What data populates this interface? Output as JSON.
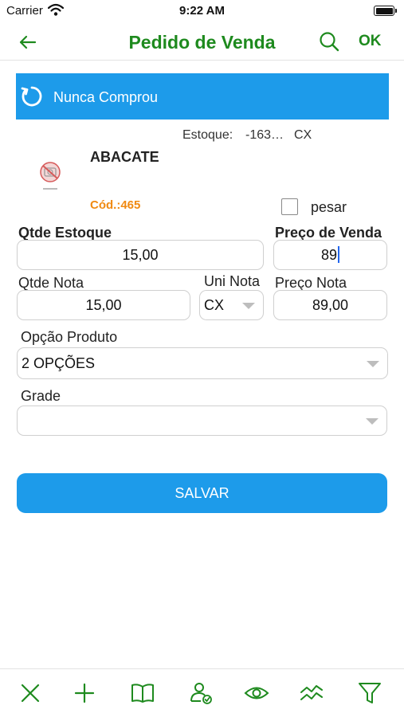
{
  "status_bar": {
    "carrier": "Carrier",
    "time": "9:22 AM"
  },
  "nav": {
    "title": "Pedido de Venda",
    "ok_label": "OK"
  },
  "banner": {
    "text": "Nunca Comprou"
  },
  "product": {
    "stock_label": "Estoque:",
    "stock_value": "-163…",
    "stock_unit": "CX",
    "name": "ABACATE",
    "code": "Cód.:465"
  },
  "weigh": {
    "label": "pesar",
    "checked": false
  },
  "form": {
    "qtde_estoque_label": "Qtde Estoque",
    "qtde_estoque_value": "15,00",
    "preco_venda_label": "Preço de Venda",
    "preco_venda_value": "89",
    "qtde_nota_label": "Qtde Nota",
    "qtde_nota_value": "15,00",
    "uni_nota_label": "Uni Nota",
    "uni_nota_value": "CX",
    "preco_nota_label": "Preço Nota",
    "preco_nota_value": "89,00",
    "opcao_produto_label": "Opção Produto",
    "opcao_produto_value": "2 OPÇÕES",
    "grade_label": "Grade",
    "grade_value": ""
  },
  "save_button": {
    "label": "SALVAR"
  },
  "toolbar": {
    "icons": [
      "close-icon",
      "plus-icon",
      "book-icon",
      "user-check-icon",
      "eye-icon",
      "trend-icon",
      "filter-icon"
    ]
  },
  "colors": {
    "accent_green": "#1e8a1e",
    "accent_blue": "#1d9bea",
    "code_orange": "#f08a12"
  }
}
